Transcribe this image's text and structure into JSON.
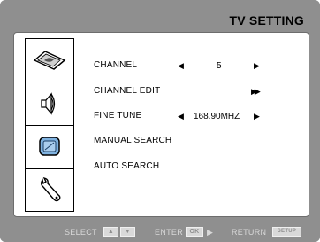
{
  "title": "TV SETTING",
  "tabs": [
    {
      "icon": "picture-icon"
    },
    {
      "icon": "speaker-icon"
    },
    {
      "icon": "tv-setting-icon"
    },
    {
      "icon": "wrench-icon"
    }
  ],
  "menu": [
    {
      "label": "CHANNEL",
      "value": "5",
      "left_arrow": "◀",
      "right_arrow": "▶"
    },
    {
      "label": "CHANNEL EDIT",
      "action": "▶▶"
    },
    {
      "label": "FINE TUNE",
      "value": "168.90MHZ",
      "left_arrow": "◀",
      "right_arrow": "▶"
    },
    {
      "label": "MANUAL SEARCH"
    },
    {
      "label": "AUTO SEARCH"
    }
  ],
  "footer": {
    "select_label": "SELECT",
    "select_up": "▲",
    "select_down": "▼",
    "enter_label": "ENTER",
    "enter_key": "OK",
    "enter_arrow": "▶",
    "return_label": "RETURN",
    "return_key": "SETUP"
  },
  "colors": {
    "background": "#8f8f8f",
    "panel": "#ffffff",
    "selected_tab_icon": "#7fb2e0",
    "footer_text": "#d9d9d9"
  }
}
